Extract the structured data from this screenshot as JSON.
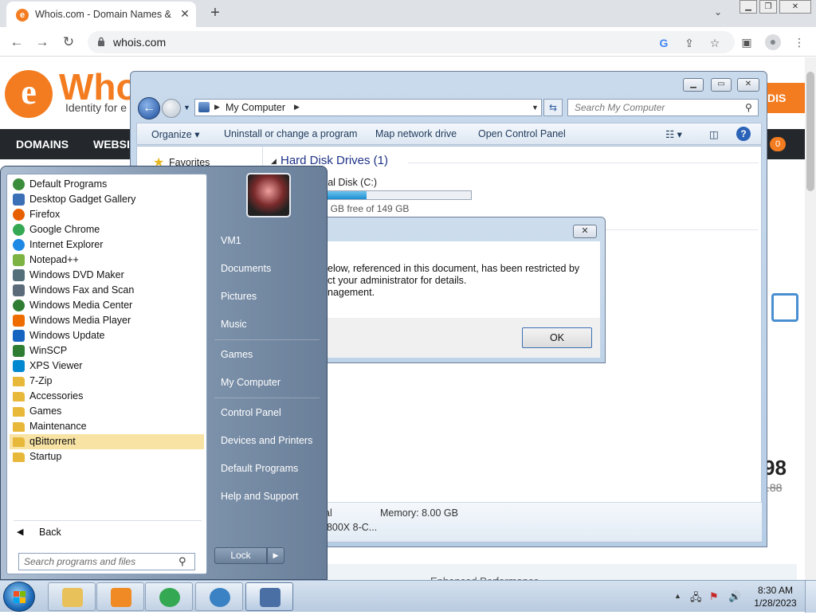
{
  "browser": {
    "tab_title": "Whois.com - Domain Names & I",
    "tab_favicon": "e",
    "tab_close": "✕",
    "new_tab": "+",
    "tab_dropdown": "⌄",
    "url": "whois.com",
    "toolbar_icons": [
      "back-icon",
      "forward-icon",
      "reload-icon",
      "lock-icon",
      "google-icon",
      "share-icon",
      "star-icon",
      "side-panel-icon",
      "profile-icon",
      "menu-icon"
    ]
  },
  "page": {
    "logo_text": "Who",
    "logo_tagline": "Identity for e",
    "nav_items": [
      "DOMAINS",
      "WEBSITE"
    ],
    "cart_count": "0",
    "orange_button": "DIS",
    "price": "98",
    "price_old": ".88",
    "footer_text": "Enhanced Performance"
  },
  "explorer": {
    "address": "My Computer",
    "search_placeholder": "Search My Computer",
    "commands": [
      "Organize ▾",
      "Uninstall or change a program",
      "Map network drive",
      "Open Control Panel"
    ],
    "nav_favorites": "Favorites",
    "section_header": "Hard Disk Drives (1)",
    "disk_name": "ocal Disk (C:)",
    "disk_free": "05 GB free of 149 GB",
    "disk_used_fraction": 0.32,
    "details_total": "al",
    "details_memory": "Memory: 8.00 GB",
    "details_processor": "5800X 8-C..."
  },
  "dialog": {
    "message": "elow, referenced in this document, has been restricted by\nct your administrator for details.\nnagement.",
    "ok_label": "OK",
    "close": "✕"
  },
  "start_menu": {
    "programs": [
      {
        "label": "Default Programs",
        "icon": "default-programs-icon",
        "color": "#3a8d3a"
      },
      {
        "label": "Desktop Gadget Gallery",
        "icon": "gadget-icon",
        "color": "#3b6fb6"
      },
      {
        "label": "Firefox",
        "icon": "firefox-icon",
        "color": "#e66000"
      },
      {
        "label": "Google Chrome",
        "icon": "chrome-icon",
        "color": "#34a853"
      },
      {
        "label": "Internet Explorer",
        "icon": "ie-icon",
        "color": "#1e88e5"
      },
      {
        "label": "Notepad++",
        "icon": "notepadpp-icon",
        "color": "#7cb342"
      },
      {
        "label": "Windows DVD Maker",
        "icon": "dvd-maker-icon",
        "color": "#546e7a"
      },
      {
        "label": "Windows Fax and Scan",
        "icon": "fax-icon",
        "color": "#5c6b7a"
      },
      {
        "label": "Windows Media Center",
        "icon": "media-center-icon",
        "color": "#2e7d32"
      },
      {
        "label": "Windows Media Player",
        "icon": "media-player-icon",
        "color": "#ef6c00"
      },
      {
        "label": "Windows Update",
        "icon": "windows-update-icon",
        "color": "#1565c0"
      },
      {
        "label": "WinSCP",
        "icon": "winscp-icon",
        "color": "#2e7d32"
      },
      {
        "label": "XPS Viewer",
        "icon": "xps-viewer-icon",
        "color": "#0288d1"
      },
      {
        "label": "7-Zip",
        "icon": "folder-icon",
        "color": "#e8b83a"
      },
      {
        "label": "Accessories",
        "icon": "folder-icon",
        "color": "#e8b83a"
      },
      {
        "label": "Games",
        "icon": "folder-icon",
        "color": "#e8b83a"
      },
      {
        "label": "Maintenance",
        "icon": "folder-icon",
        "color": "#e8b83a"
      },
      {
        "label": "qBittorrent",
        "icon": "folder-icon",
        "color": "#e8b83a",
        "highlighted": true
      },
      {
        "label": "Startup",
        "icon": "folder-icon",
        "color": "#e8b83a"
      }
    ],
    "back_label": "Back",
    "search_placeholder": "Search programs and files",
    "right_items": [
      "VM1",
      "Documents",
      "Pictures",
      "Music",
      "Games",
      "My Computer",
      "Control Panel",
      "Devices and Printers",
      "Default Programs",
      "Help and Support"
    ],
    "lock_label": "Lock",
    "lock_arrow": "▶"
  },
  "taskbar": {
    "buttons": [
      {
        "name": "explorer-icon",
        "color": "#e8c15a"
      },
      {
        "name": "media-player-icon",
        "color": "#f08a24"
      },
      {
        "name": "chrome-icon",
        "color": "#34a853"
      },
      {
        "name": "qbittorrent-icon",
        "color": "#3b82c4"
      },
      {
        "name": "network-computer-icon",
        "color": "#4a6fa5"
      }
    ],
    "time": "8:30 AM",
    "date": "1/28/2023",
    "tray_icons": [
      "show-hidden-icon",
      "network-icon",
      "action-center-icon",
      "volume-icon"
    ]
  }
}
